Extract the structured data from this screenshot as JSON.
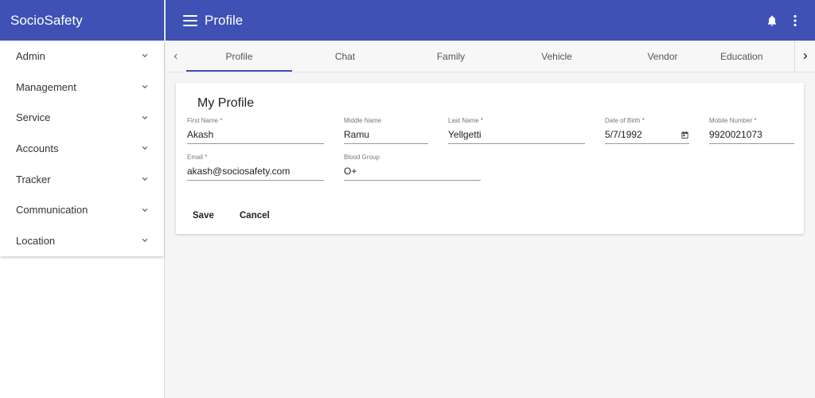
{
  "app": {
    "brand": "SocioSafety",
    "page_title": "Profile"
  },
  "sidebar": {
    "items": [
      {
        "label": "Admin"
      },
      {
        "label": "Management"
      },
      {
        "label": "Service"
      },
      {
        "label": "Accounts"
      },
      {
        "label": "Tracker"
      },
      {
        "label": "Communication"
      },
      {
        "label": "Location"
      }
    ]
  },
  "tabs": [
    {
      "label": "Profile",
      "active": true
    },
    {
      "label": "Chat"
    },
    {
      "label": "Family"
    },
    {
      "label": "Vehicle"
    },
    {
      "label": "Vendor"
    },
    {
      "label": "Education"
    }
  ],
  "profile": {
    "title": "My Profile",
    "first_name": {
      "label": "First Name *",
      "value": "Akash"
    },
    "middle_name": {
      "label": "Middle Name",
      "value": "Ramu"
    },
    "last_name": {
      "label": "Last Name *",
      "value": "Yellgetti"
    },
    "dob": {
      "label": "Date of Birth *",
      "value": "5/7/1992"
    },
    "mobile": {
      "label": "Mobile Number *",
      "value": "9920021073"
    },
    "email": {
      "label": "Email *",
      "value": "akash@sociosafety.com"
    },
    "blood_group": {
      "label": "Blood Group",
      "value": "O+"
    },
    "save_label": "Save",
    "cancel_label": "Cancel"
  },
  "colors": {
    "primary": "#3f51b5",
    "background": "#f5f5f5"
  },
  "icons": {
    "menu": "hamburger-icon",
    "notifications": "bell-icon",
    "more": "more-vert-icon",
    "calendar": "calendar-icon"
  }
}
